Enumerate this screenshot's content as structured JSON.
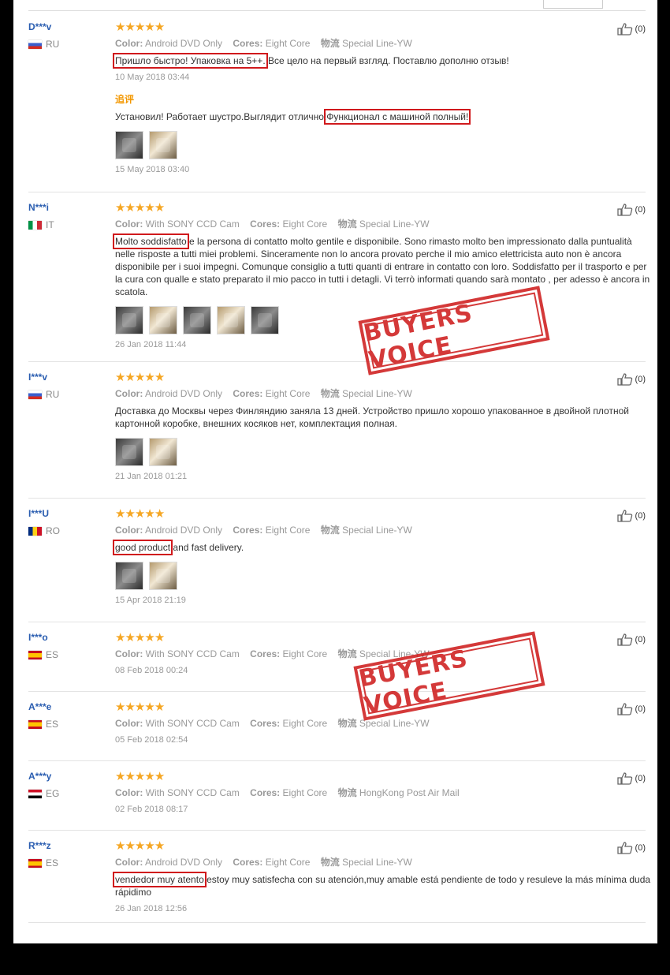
{
  "labels": {
    "color": "Color:",
    "cores": "Cores:",
    "logistics": "物流",
    "additional": "追评"
  },
  "stamp_text": "BUYERS VOICE",
  "reviews": [
    {
      "name": "D***v",
      "country": "RU",
      "flag": "ru",
      "color": "Android DVD Only",
      "cores": "Eight Core",
      "logistics": "Special Line-YW",
      "text_hl": "Пришло быстро! Упаковка на 5++.",
      "text": " Все цело на первый взгляд. Поставлю дополню отзыв!",
      "date": "10 May 2018 03:44",
      "likes": "(0)",
      "followup": {
        "text": "Установил! Работает шустро.Выглядит отлично!",
        "text_hl": "Функционал с машиной полный!",
        "date": "15 May 2018 03:40"
      }
    },
    {
      "name": "N***i",
      "country": "IT",
      "flag": "it",
      "color": "With SONY CCD Cam",
      "cores": "Eight Core",
      "logistics": "Special Line-YW",
      "text_hl": "Molto soddisfatto",
      "text": " e la persona di contatto molto gentile e disponibile. Sono rimasto molto ben impressionato dalla puntualità nelle risposte a tutti miei problemi. Sinceramente non lo ancora provato perche il mio amico elettricista auto non è ancora disponibile per i suoi impegni. Comunque consiglio a tutti quanti di entrare in contatto con loro. Soddisfatto per il trasporto e per la cura con qualle e stato preparato il mio pacco in tutti i detagli. Vi terrò informati quando sarà montato , per adesso è ancora in scatola.",
      "date": "26 Jan 2018 11:44",
      "likes": "(0)"
    },
    {
      "name": "I***v",
      "country": "RU",
      "flag": "ru",
      "color": "Android DVD Only",
      "cores": "Eight Core",
      "logistics": "Special Line-YW",
      "text_hl": "",
      "text": "Доставка до Москвы через Финляндию заняла 13 дней. Устройство пришло хорошо упакованное в двойной плотной картонной коробке, внешних косяков нет, комплектация полная.",
      "date": "21 Jan 2018 01:21",
      "likes": "(0)"
    },
    {
      "name": "I***U",
      "country": "RO",
      "flag": "ro",
      "color": "Android DVD Only",
      "cores": "Eight Core",
      "logistics": "Special Line-YW",
      "text_hl": "good product",
      "text": " and fast delivery.",
      "date": "15 Apr 2018 21:19",
      "likes": "(0)"
    },
    {
      "name": "I***o",
      "country": "ES",
      "flag": "es",
      "color": "With SONY CCD Cam",
      "cores": "Eight Core",
      "logistics": "Special Line-YW",
      "date": "08 Feb 2018 00:24",
      "likes": "(0)"
    },
    {
      "name": "A***e",
      "country": "ES",
      "flag": "es",
      "color": "With SONY CCD Cam",
      "cores": "Eight Core",
      "logistics": "Special Line-YW",
      "date": "05 Feb 2018 02:54",
      "likes": "(0)"
    },
    {
      "name": "A***y",
      "country": "EG",
      "flag": "eg",
      "color": "With SONY CCD Cam",
      "cores": "Eight Core",
      "logistics": "HongKong Post Air Mail",
      "date": "02 Feb 2018 08:17",
      "likes": "(0)"
    },
    {
      "name": "R***z",
      "country": "ES",
      "flag": "es",
      "color": "Android DVD Only",
      "cores": "Eight Core",
      "logistics": "Special Line-YW",
      "text_hl": "vendedor muy atento",
      "text": ",estoy muy satisfecha con su atención,muy amable está pendiente de todo y resuleve la más mínima duda rápidimo",
      "date": "26 Jan 2018 12:56",
      "likes": "(0)"
    }
  ]
}
